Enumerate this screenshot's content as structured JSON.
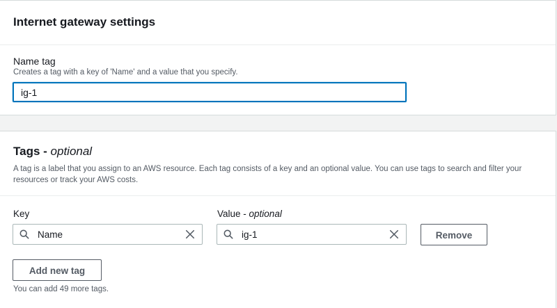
{
  "gateway_settings": {
    "title": "Internet gateway settings",
    "name_tag": {
      "label": "Name tag",
      "description": "Creates a tag with a key of 'Name' and a value that you specify.",
      "value": "ig-1"
    }
  },
  "tags": {
    "title": "Tags - ",
    "title_optional": "optional",
    "description": "A tag is a label that you assign to an AWS resource. Each tag consists of a key and an optional value. You can use tags to search and filter your resources or track your AWS costs.",
    "key_label": "Key",
    "value_label": "Value - ",
    "value_label_optional": "optional",
    "rows": [
      {
        "key": "Name",
        "value": "ig-1",
        "remove_label": "Remove"
      }
    ],
    "add_button_label": "Add new tag",
    "remaining_hint": "You can add 49 more tags."
  },
  "icons": {
    "search": "search-icon",
    "clear": "close-icon"
  },
  "colors": {
    "focus_border": "#0073bb",
    "text": "#16191f",
    "secondary_text": "#545b64",
    "background": "#f2f3f3"
  }
}
